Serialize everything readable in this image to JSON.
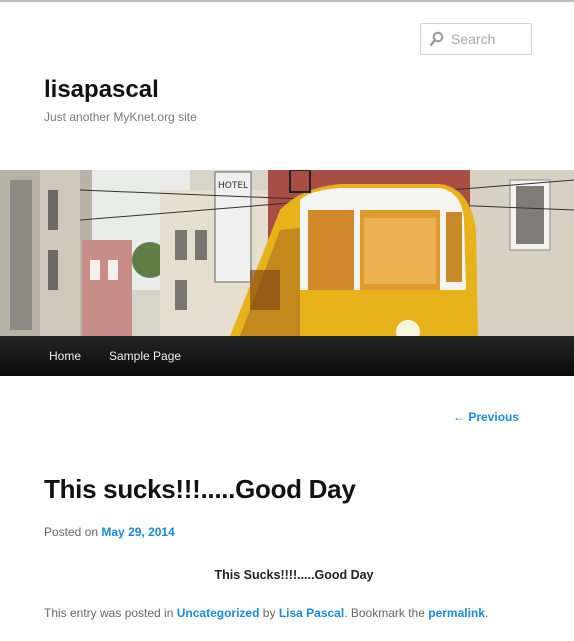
{
  "search": {
    "placeholder": "Search"
  },
  "site": {
    "title": "lisapascal",
    "description": "Just another MyKnet.org site"
  },
  "nav": {
    "items": [
      {
        "label": "Home"
      },
      {
        "label": "Sample Page"
      }
    ]
  },
  "post_nav": {
    "previous_label": "← Previous"
  },
  "post": {
    "title": "This sucks!!!.....Good Day",
    "posted_on_label": "Posted on",
    "date": "May 29, 2014",
    "body": "This Sucks!!!!.....Good Day",
    "footer": {
      "prefix": "This entry was posted in",
      "category": "Uncategorized",
      "by_label": "by",
      "author": "Lisa Pascal",
      "bookmark_label": ". Bookmark the",
      "permalink_label": "permalink",
      "suffix": "."
    }
  },
  "header_image": {
    "sign_text": "HOTEL"
  },
  "colors": {
    "link": "#1b8be0",
    "nav_bg": "#111111",
    "tram_yellow": "#e8b21a"
  }
}
